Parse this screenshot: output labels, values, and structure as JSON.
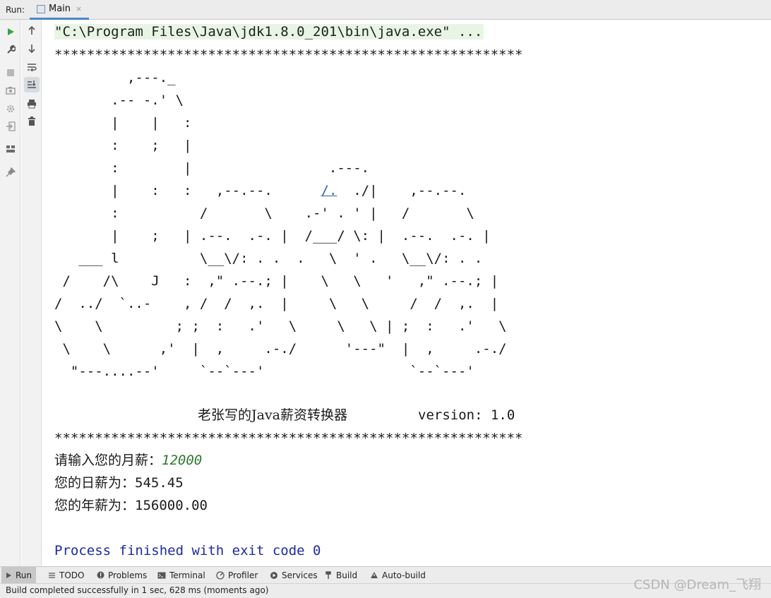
{
  "tool_window": {
    "label": "Run:",
    "tab": "Main",
    "tab_close": "×"
  },
  "left_toolbar": [
    {
      "name": "run-icon",
      "color": "#3aa540"
    },
    {
      "name": "wrench-icon"
    },
    {
      "name": "stop-icon"
    },
    {
      "name": "camera-icon"
    },
    {
      "name": "gear-icon"
    },
    {
      "name": "exit-icon"
    },
    {
      "name": "layout-icon"
    },
    {
      "name": "pin-icon"
    }
  ],
  "right_toolbar": [
    {
      "name": "arrow-up-icon"
    },
    {
      "name": "arrow-down-icon"
    },
    {
      "name": "soft-wrap-icon"
    },
    {
      "name": "scroll-to-end-icon",
      "selected": true
    },
    {
      "name": "print-icon"
    },
    {
      "name": "trash-icon"
    }
  ],
  "console": {
    "command": "\"C:\\Program Files\\Java\\jdk1.8.0_201\\bin\\java.exe\" ...",
    "banner_border": "**********************************************************",
    "ascii_art": [
      "         ,---._",
      "       .-- -.' \\",
      "       |    |   :",
      "       :    ;   |",
      "       :        |                 .---.",
      "       |    :   :   ,--.--.      ",
      "       :          /       \\    .-' . ' |   /       \\",
      "       |    ;   | .--.  .-. |  /___/ \\: |  .--.  .-. |",
      "   ___ l          \\__\\/: . .  .   \\  ' .   \\__\\/: . .",
      " /    /\\    J   :  ,\" .--.; |    \\   \\   '   ,\" .--.; |",
      "/  ../  `..-    , /  /  ,.  |     \\   \\     /  /  ,.  |",
      "\\    \\         ; ;  :   .'   \\     \\   \\ | ;  :   .'   \\",
      " \\    \\      ,'  |  ,     .-./      '---\"  |  ,     .-./",
      "  \"---....--'     `--`---'                  `--`---'"
    ],
    "art_row6_link": "/.",
    "art_row6_tail": "  ./|    ,--.--.",
    "title_cn": "老张写的Java薪资转换器",
    "version_label": "version: 1.0",
    "prompt_monthly": "请输入您的月薪：",
    "input_value": "12000",
    "daily_label": "您的日薪为：",
    "daily_value": "545.45",
    "yearly_label": "您的年薪为：",
    "yearly_value": "156000.00",
    "exit_message": "Process finished with exit code 0"
  },
  "bottom_tabs": [
    {
      "label": "Run",
      "icon": "play-icon",
      "active": true
    },
    {
      "label": "TODO",
      "icon": "list-icon"
    },
    {
      "label": "Problems",
      "icon": "info-icon"
    },
    {
      "label": "Terminal",
      "icon": "terminal-icon"
    },
    {
      "label": "Profiler",
      "icon": "profiler-icon"
    },
    {
      "label": "Services",
      "icon": "services-icon"
    },
    {
      "label": "Build",
      "icon": "hammer-icon"
    },
    {
      "label": "Auto-build",
      "icon": "warning-icon"
    }
  ],
  "status": {
    "message": "Build completed successfully in 1 sec, 628 ms (moments ago)"
  },
  "watermark": "CSDN @Dream_飞翔"
}
